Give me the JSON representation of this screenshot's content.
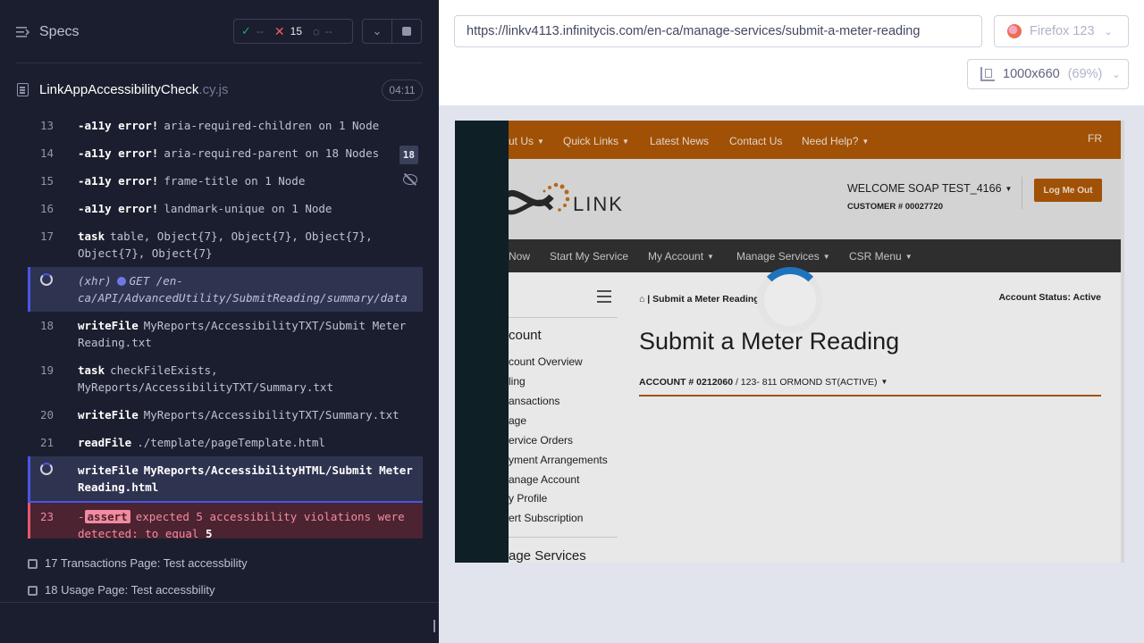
{
  "reporter": {
    "title": "Specs",
    "stats": {
      "passed": "--",
      "failed": "15",
      "pending": "--"
    },
    "spec_file": {
      "name": "LinkAppAccessibilityCheck",
      "ext": ".cy.js",
      "duration": "04:11"
    },
    "commands": [
      {
        "num": "13",
        "name": "-a11y error!",
        "msg": "aria-required-children on 1 Node"
      },
      {
        "num": "14",
        "name": "-a11y error!",
        "msg": "aria-required-parent on 18 Nodes",
        "badge": "18"
      },
      {
        "num": "15",
        "name": "-a11y error!",
        "msg": "frame-title on 1 Node"
      },
      {
        "num": "16",
        "name": "-a11y error!",
        "msg": "landmark-unique on 1 Node"
      },
      {
        "num": "17",
        "name": "task",
        "msg": "table, Object{7}, Object{7}, Object{7}, Object{7}, Object{7}"
      },
      {
        "num": "",
        "name": "(xhr)",
        "msg": "GET /en-ca/API/AdvancedUtility/SubmitReading/summary/data"
      },
      {
        "num": "18",
        "name": "writeFile",
        "msg": "MyReports/AccessibilityTXT/Submit Meter Reading.txt"
      },
      {
        "num": "19",
        "name": "task",
        "msg": "checkFileExists, MyReports/AccessibilityTXT/Summary.txt"
      },
      {
        "num": "20",
        "name": "writeFile",
        "msg": "MyReports/AccessibilityTXT/Summary.txt"
      },
      {
        "num": "21",
        "name": "readFile",
        "msg": "./template/pageTemplate.html"
      },
      {
        "num": "",
        "name": "writeFile",
        "msg": "MyReports/AccessibilityHTML/Submit Meter Reading.html"
      },
      {
        "num": "23",
        "name": "assert",
        "msg_a": "expected 5 accessibility violations were detected: to equal",
        "msg_b": "5"
      }
    ],
    "tests": [
      {
        "label": "17 Transactions Page: Test accessbility"
      },
      {
        "label": "18 Usage Page: Test accessbility"
      }
    ]
  },
  "browser": {
    "url": "https://linkv4113.infinitycis.com/en-ca/manage-services/submit-a-meter-reading",
    "name": "Firefox 123",
    "viewport": "1000x660",
    "zoom": "(69%)"
  },
  "site": {
    "top_nav": [
      "ut Us",
      "Quick Links",
      "Latest News",
      "Contact Us",
      "Need Help?"
    ],
    "lang": "FR",
    "logo_text": "LINK",
    "welcome": "WELCOME SOAP TEST_4166",
    "customer": "CUSTOMER # 00027720",
    "logout": "Log Me Out",
    "main_nav": [
      "Now",
      "Start My Service",
      "My Account",
      "Manage Services",
      "CSR Menu"
    ],
    "sidebar": {
      "heading": "count",
      "items": [
        "count Overview",
        "ling",
        "ansactions",
        "age",
        "ervice Orders",
        "yment Arrangements",
        "anage Account",
        "y Profile",
        "ert Subscription"
      ],
      "heading2": "age Services"
    },
    "breadcrumb": "| Submit a Meter Reading",
    "account_status": "Account Status: Active",
    "page_title": "Submit a Meter Reading",
    "account_label": "ACCOUNT # 0212060",
    "account_address": "/ 123- 811 ORMOND ST(ACTIVE)"
  },
  "colors": {
    "brand_orange": "#b05a07",
    "reporter_bg": "#1b1e2e",
    "accent": "#4956e3",
    "fail": "#e45770"
  }
}
